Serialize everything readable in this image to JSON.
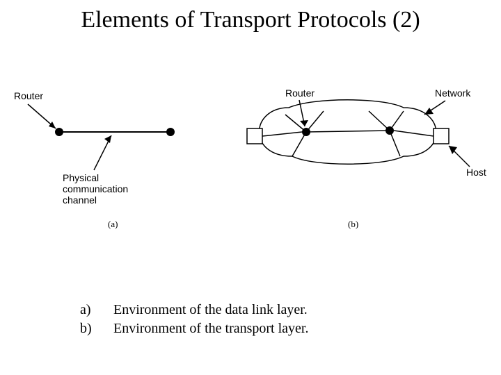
{
  "title": "Elements of Transport Protocols (2)",
  "labels": {
    "routerA": "Router",
    "phys": "Physical\ncommunication\nchannel",
    "routerB": "Router",
    "network": "Network",
    "host": "Host"
  },
  "captions": {
    "a": "(a)",
    "b": "(b)"
  },
  "legend": {
    "a_key": "a)",
    "a_txt": "Environment of the data link layer.",
    "b_key": "b)",
    "b_txt": "Environment of the transport layer."
  }
}
